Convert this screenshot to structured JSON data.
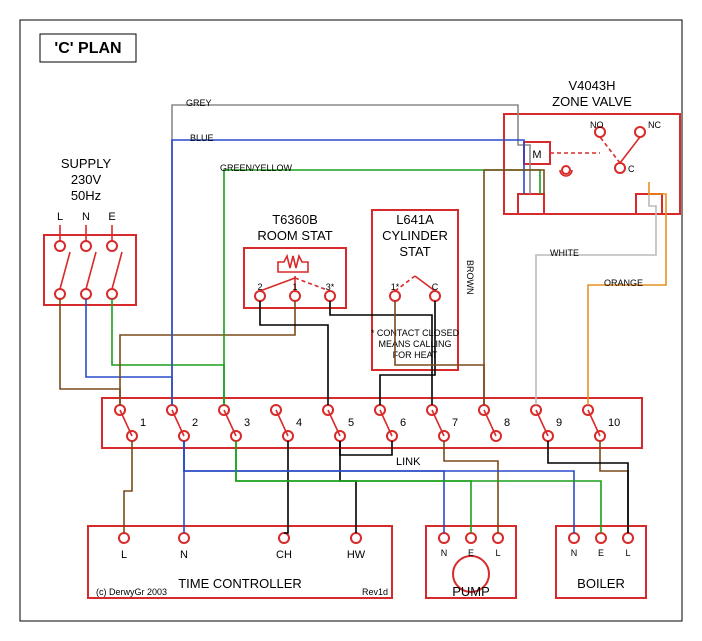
{
  "title": "'C' PLAN",
  "supply": {
    "label": "SUPPLY",
    "voltage": "230V",
    "freq": "50Hz",
    "L": "L",
    "N": "N",
    "E": "E"
  },
  "roomstat": {
    "model": "T6360B",
    "label": "ROOM STAT",
    "t1": "2",
    "t2": "1",
    "t3": "3*"
  },
  "cylstat": {
    "model": "L641A",
    "label1": "CYLINDER",
    "label2": "STAT",
    "t1": "1*",
    "t2": "C",
    "note1": "* CONTACT CLOSED",
    "note2": "MEANS CALLING",
    "note3": "FOR HEAT"
  },
  "zonevalve": {
    "model": "V4043H",
    "label": "ZONE VALVE",
    "M": "M",
    "NO": "NO",
    "NC": "NC",
    "C": "C"
  },
  "junction": {
    "t1": "1",
    "t2": "2",
    "t3": "3",
    "t4": "4",
    "t5": "5",
    "t6": "6",
    "t7": "7",
    "t8": "8",
    "t9": "9",
    "t10": "10",
    "link": "LINK"
  },
  "timecontroller": {
    "label": "TIME CONTROLLER",
    "L": "L",
    "N": "N",
    "CH": "CH",
    "HW": "HW",
    "rev": "Rev1d",
    "copy": "(c) DerwyGr 2003"
  },
  "pump": {
    "label": "PUMP",
    "N": "N",
    "E": "E",
    "L": "L"
  },
  "boiler": {
    "label": "BOILER",
    "N": "N",
    "E": "E",
    "L": "L"
  },
  "wirelabels": {
    "grey": "GREY",
    "blue": "BLUE",
    "greenyellow": "GREEN/YELLOW",
    "brown": "BROWN",
    "white": "WHITE",
    "orange": "ORANGE"
  }
}
